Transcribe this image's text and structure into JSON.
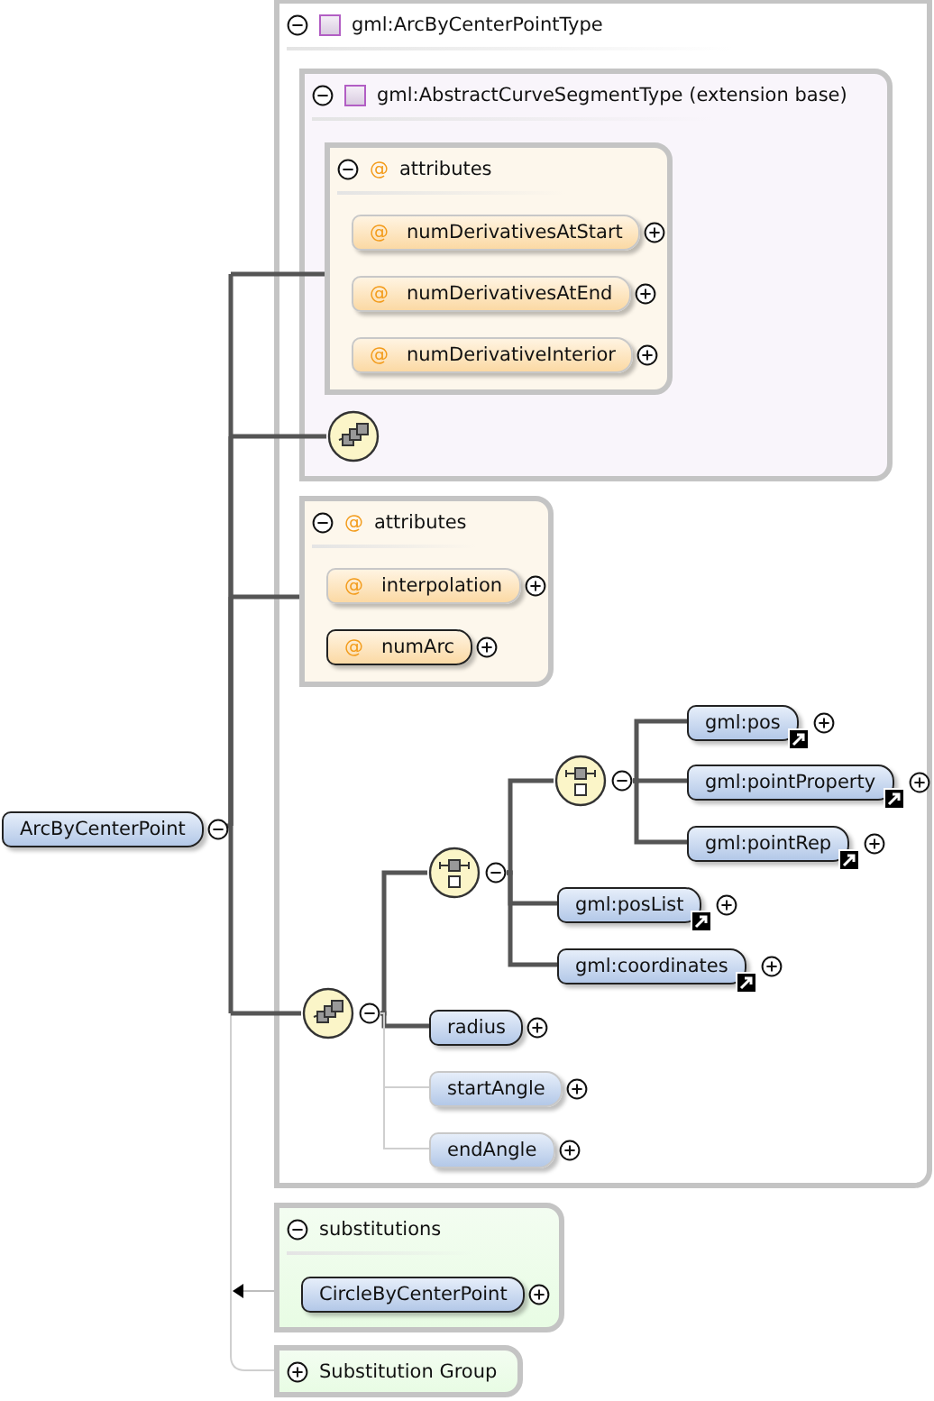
{
  "root": {
    "name": "ArcByCenterPoint",
    "expanded": true
  },
  "type": {
    "name": "gml:ArcByCenterPointType",
    "expanded": true,
    "base": {
      "name": "gml:AbstractCurveSegmentType (extension base)",
      "expanded": true,
      "attributes": {
        "marker": "@",
        "label": "attributes",
        "expanded": true,
        "items": [
          {
            "marker": "@",
            "name": "numDerivativesAtStart",
            "required": false,
            "expanded": false
          },
          {
            "marker": "@",
            "name": "numDerivativesAtEnd",
            "required": false,
            "expanded": false
          },
          {
            "marker": "@",
            "name": "numDerivativeInterior",
            "required": false,
            "expanded": false
          }
        ]
      },
      "content": {
        "kind": "sequence"
      }
    },
    "attributes": {
      "marker": "@",
      "label": "attributes",
      "expanded": true,
      "items": [
        {
          "marker": "@",
          "name": "interpolation",
          "required": false,
          "expanded": false
        },
        {
          "marker": "@",
          "name": "numArc",
          "required": true,
          "expanded": false
        }
      ]
    },
    "content": {
      "kind": "sequence",
      "expanded": true,
      "children": [
        {
          "kind": "choice",
          "expanded": true,
          "children": [
            {
              "kind": "choice",
              "expanded": true,
              "children": [
                {
                  "kind": "element",
                  "name": "gml:pos",
                  "reference": true,
                  "optional": false,
                  "expanded": false
                },
                {
                  "kind": "element",
                  "name": "gml:pointProperty",
                  "reference": true,
                  "optional": false,
                  "expanded": false
                },
                {
                  "kind": "element",
                  "name": "gml:pointRep",
                  "reference": true,
                  "optional": false,
                  "expanded": false
                }
              ]
            },
            {
              "kind": "element",
              "name": "gml:posList",
              "reference": true,
              "optional": false,
              "expanded": false
            },
            {
              "kind": "element",
              "name": "gml:coordinates",
              "reference": true,
              "optional": false,
              "expanded": false
            }
          ]
        },
        {
          "kind": "element",
          "name": "radius",
          "reference": false,
          "optional": false,
          "expanded": false
        },
        {
          "kind": "element",
          "name": "startAngle",
          "reference": false,
          "optional": true,
          "expanded": false
        },
        {
          "kind": "element",
          "name": "endAngle",
          "reference": false,
          "optional": true,
          "expanded": false
        }
      ]
    }
  },
  "substitutions": {
    "label": "substitutions",
    "expanded": true,
    "items": [
      {
        "name": "CircleByCenterPoint",
        "reference": false,
        "optional": false,
        "expanded": false
      }
    ]
  },
  "substitution_group": {
    "label": "Substitution Group",
    "expanded": false
  }
}
